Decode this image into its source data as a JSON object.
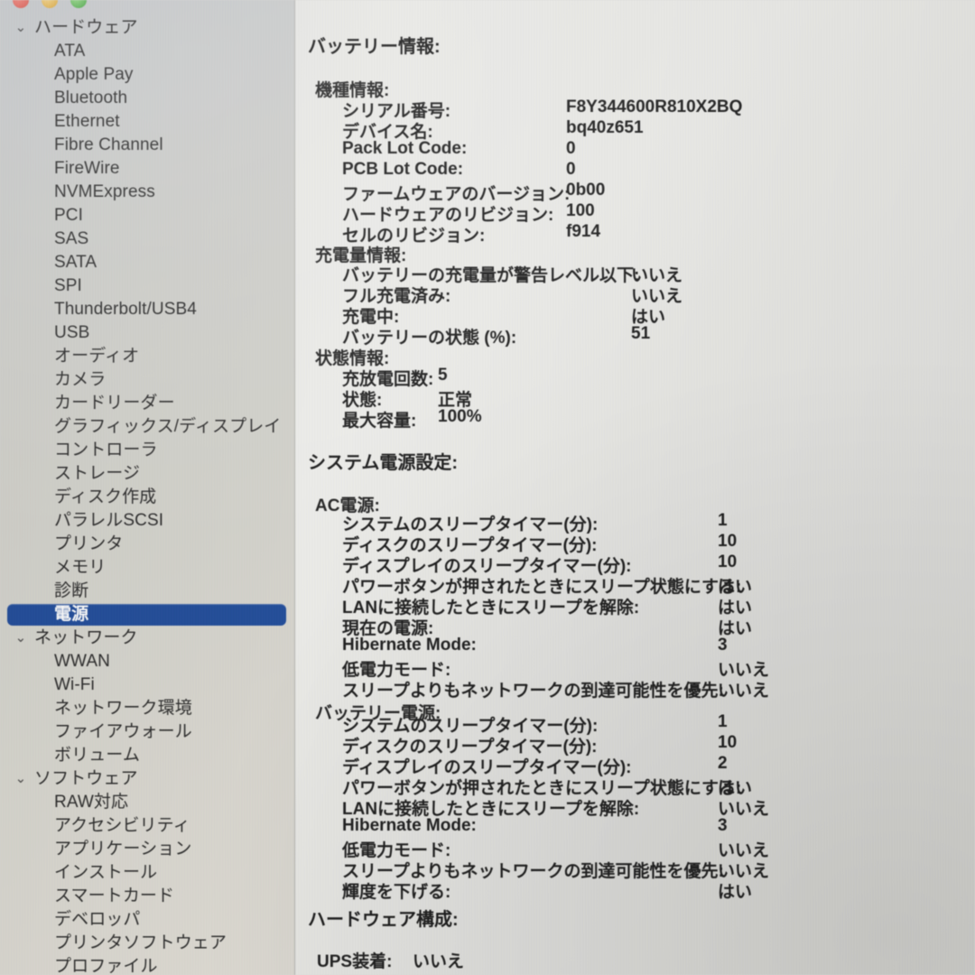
{
  "window": {
    "traffic_lights": [
      "close",
      "minimize",
      "zoom"
    ]
  },
  "sidebar": {
    "items": [
      {
        "label": "ハードウェア",
        "level": "group",
        "expanded": true,
        "selected": false
      },
      {
        "label": "ATA",
        "level": "child",
        "selected": false
      },
      {
        "label": "Apple Pay",
        "level": "child",
        "selected": false
      },
      {
        "label": "Bluetooth",
        "level": "child",
        "selected": false
      },
      {
        "label": "Ethernet",
        "level": "child",
        "selected": false
      },
      {
        "label": "Fibre Channel",
        "level": "child",
        "selected": false
      },
      {
        "label": "FireWire",
        "level": "child",
        "selected": false
      },
      {
        "label": "NVMExpress",
        "level": "child",
        "selected": false
      },
      {
        "label": "PCI",
        "level": "child",
        "selected": false
      },
      {
        "label": "SAS",
        "level": "child",
        "selected": false
      },
      {
        "label": "SATA",
        "level": "child",
        "selected": false
      },
      {
        "label": "SPI",
        "level": "child",
        "selected": false
      },
      {
        "label": "Thunderbolt/USB4",
        "level": "child",
        "selected": false
      },
      {
        "label": "USB",
        "level": "child",
        "selected": false
      },
      {
        "label": "オーディオ",
        "level": "child",
        "selected": false
      },
      {
        "label": "カメラ",
        "level": "child",
        "selected": false
      },
      {
        "label": "カードリーダー",
        "level": "child",
        "selected": false
      },
      {
        "label": "グラフィックス/ディスプレイ",
        "level": "child",
        "selected": false
      },
      {
        "label": "コントローラ",
        "level": "child",
        "selected": false
      },
      {
        "label": "ストレージ",
        "level": "child",
        "selected": false
      },
      {
        "label": "ディスク作成",
        "level": "child",
        "selected": false
      },
      {
        "label": "パラレルSCSI",
        "level": "child",
        "selected": false
      },
      {
        "label": "プリンタ",
        "level": "child",
        "selected": false
      },
      {
        "label": "メモリ",
        "level": "child",
        "selected": false
      },
      {
        "label": "診断",
        "level": "child",
        "selected": false
      },
      {
        "label": "電源",
        "level": "child",
        "selected": true
      },
      {
        "label": "ネットワーク",
        "level": "group",
        "expanded": true,
        "selected": false
      },
      {
        "label": "WWAN",
        "level": "child",
        "selected": false
      },
      {
        "label": "Wi-Fi",
        "level": "child",
        "selected": false
      },
      {
        "label": "ネットワーク環境",
        "level": "child",
        "selected": false
      },
      {
        "label": "ファイアウォール",
        "level": "child",
        "selected": false
      },
      {
        "label": "ボリューム",
        "level": "child",
        "selected": false
      },
      {
        "label": "ソフトウェア",
        "level": "group",
        "expanded": true,
        "selected": false
      },
      {
        "label": "RAW対応",
        "level": "child",
        "selected": false
      },
      {
        "label": "アクセシビリティ",
        "level": "child",
        "selected": false
      },
      {
        "label": "アプリケーション",
        "level": "child",
        "selected": false
      },
      {
        "label": "インストール",
        "level": "child",
        "selected": false
      },
      {
        "label": "スマートカード",
        "level": "child",
        "selected": false
      },
      {
        "label": "デベロッパ",
        "level": "child",
        "selected": false
      },
      {
        "label": "プリンタソフトウェア",
        "level": "child",
        "selected": false
      },
      {
        "label": "プロファイル",
        "level": "child",
        "selected": false
      }
    ],
    "chevron_glyph": "⌄",
    "selection_color": "#1d4da3"
  },
  "content": {
    "battery_section_title": "バッテリー情報:",
    "model_info": {
      "heading": "機種情報:",
      "rows": [
        {
          "key": "シリアル番号:",
          "value": "F8Y344600R810X2BQ"
        },
        {
          "key": "デバイス名:",
          "value": "bq40z651"
        },
        {
          "key": "Pack Lot Code:",
          "value": "0"
        },
        {
          "key": "PCB Lot Code:",
          "value": "0"
        },
        {
          "key": "ファームウェアのバージョン:",
          "value": "0b00"
        },
        {
          "key": "ハードウェアのリビジョン:",
          "value": "100"
        },
        {
          "key": "セルのリビジョン:",
          "value": "f914"
        }
      ]
    },
    "charge_info": {
      "heading": "充電量情報:",
      "rows": [
        {
          "key": "バッテリーの充電量が警告レベル以下:",
          "value": "いいえ"
        },
        {
          "key": "フル充電済み:",
          "value": "いいえ"
        },
        {
          "key": "充電中:",
          "value": "はい"
        },
        {
          "key": "バッテリーの状態 (%):",
          "value": "51"
        }
      ]
    },
    "health_info": {
      "heading": "状態情報:",
      "rows": [
        {
          "key": "充放電回数:",
          "value": "5"
        },
        {
          "key": "状態:",
          "value": "正常"
        },
        {
          "key": "最大容量:",
          "value": "100%"
        }
      ]
    },
    "power_settings_title": "システム電源設定:",
    "ac_power": {
      "heading": "AC電源:",
      "rows": [
        {
          "key": "システムのスリープタイマー(分):",
          "value": "1"
        },
        {
          "key": "ディスクのスリープタイマー(分):",
          "value": "10"
        },
        {
          "key": "ディスプレイのスリープタイマー(分):",
          "value": "10"
        },
        {
          "key": "パワーボタンが押されたときにスリープ状態にする:",
          "value": "はい"
        },
        {
          "key": "LANに接続したときにスリープを解除:",
          "value": "はい"
        },
        {
          "key": "現在の電源:",
          "value": "はい"
        },
        {
          "key": "Hibernate Mode:",
          "value": "3"
        },
        {
          "key": "低電力モード:",
          "value": "いいえ"
        },
        {
          "key": "スリープよりもネットワークの到達可能性を優先:",
          "value": "いいえ"
        }
      ]
    },
    "battery_power": {
      "heading": "バッテリー電源:",
      "rows": [
        {
          "key": "システムのスリープタイマー(分):",
          "value": "1"
        },
        {
          "key": "ディスクのスリープタイマー(分):",
          "value": "10"
        },
        {
          "key": "ディスプレイのスリープタイマー(分):",
          "value": "2"
        },
        {
          "key": "パワーボタンが押されたときにスリープ状態にする:",
          "value": "はい"
        },
        {
          "key": "LANに接続したときにスリープを解除:",
          "value": "いいえ"
        },
        {
          "key": "Hibernate Mode:",
          "value": "3"
        },
        {
          "key": "低電力モード:",
          "value": "いいえ"
        },
        {
          "key": "スリープよりもネットワークの到達可能性を優先:",
          "value": "いいえ"
        },
        {
          "key": "輝度を下げる:",
          "value": "はい"
        }
      ]
    },
    "hardware_config": {
      "heading": "ハードウェア構成:",
      "rows": [
        {
          "key": "UPS装着:",
          "value": "いいえ"
        }
      ]
    }
  }
}
